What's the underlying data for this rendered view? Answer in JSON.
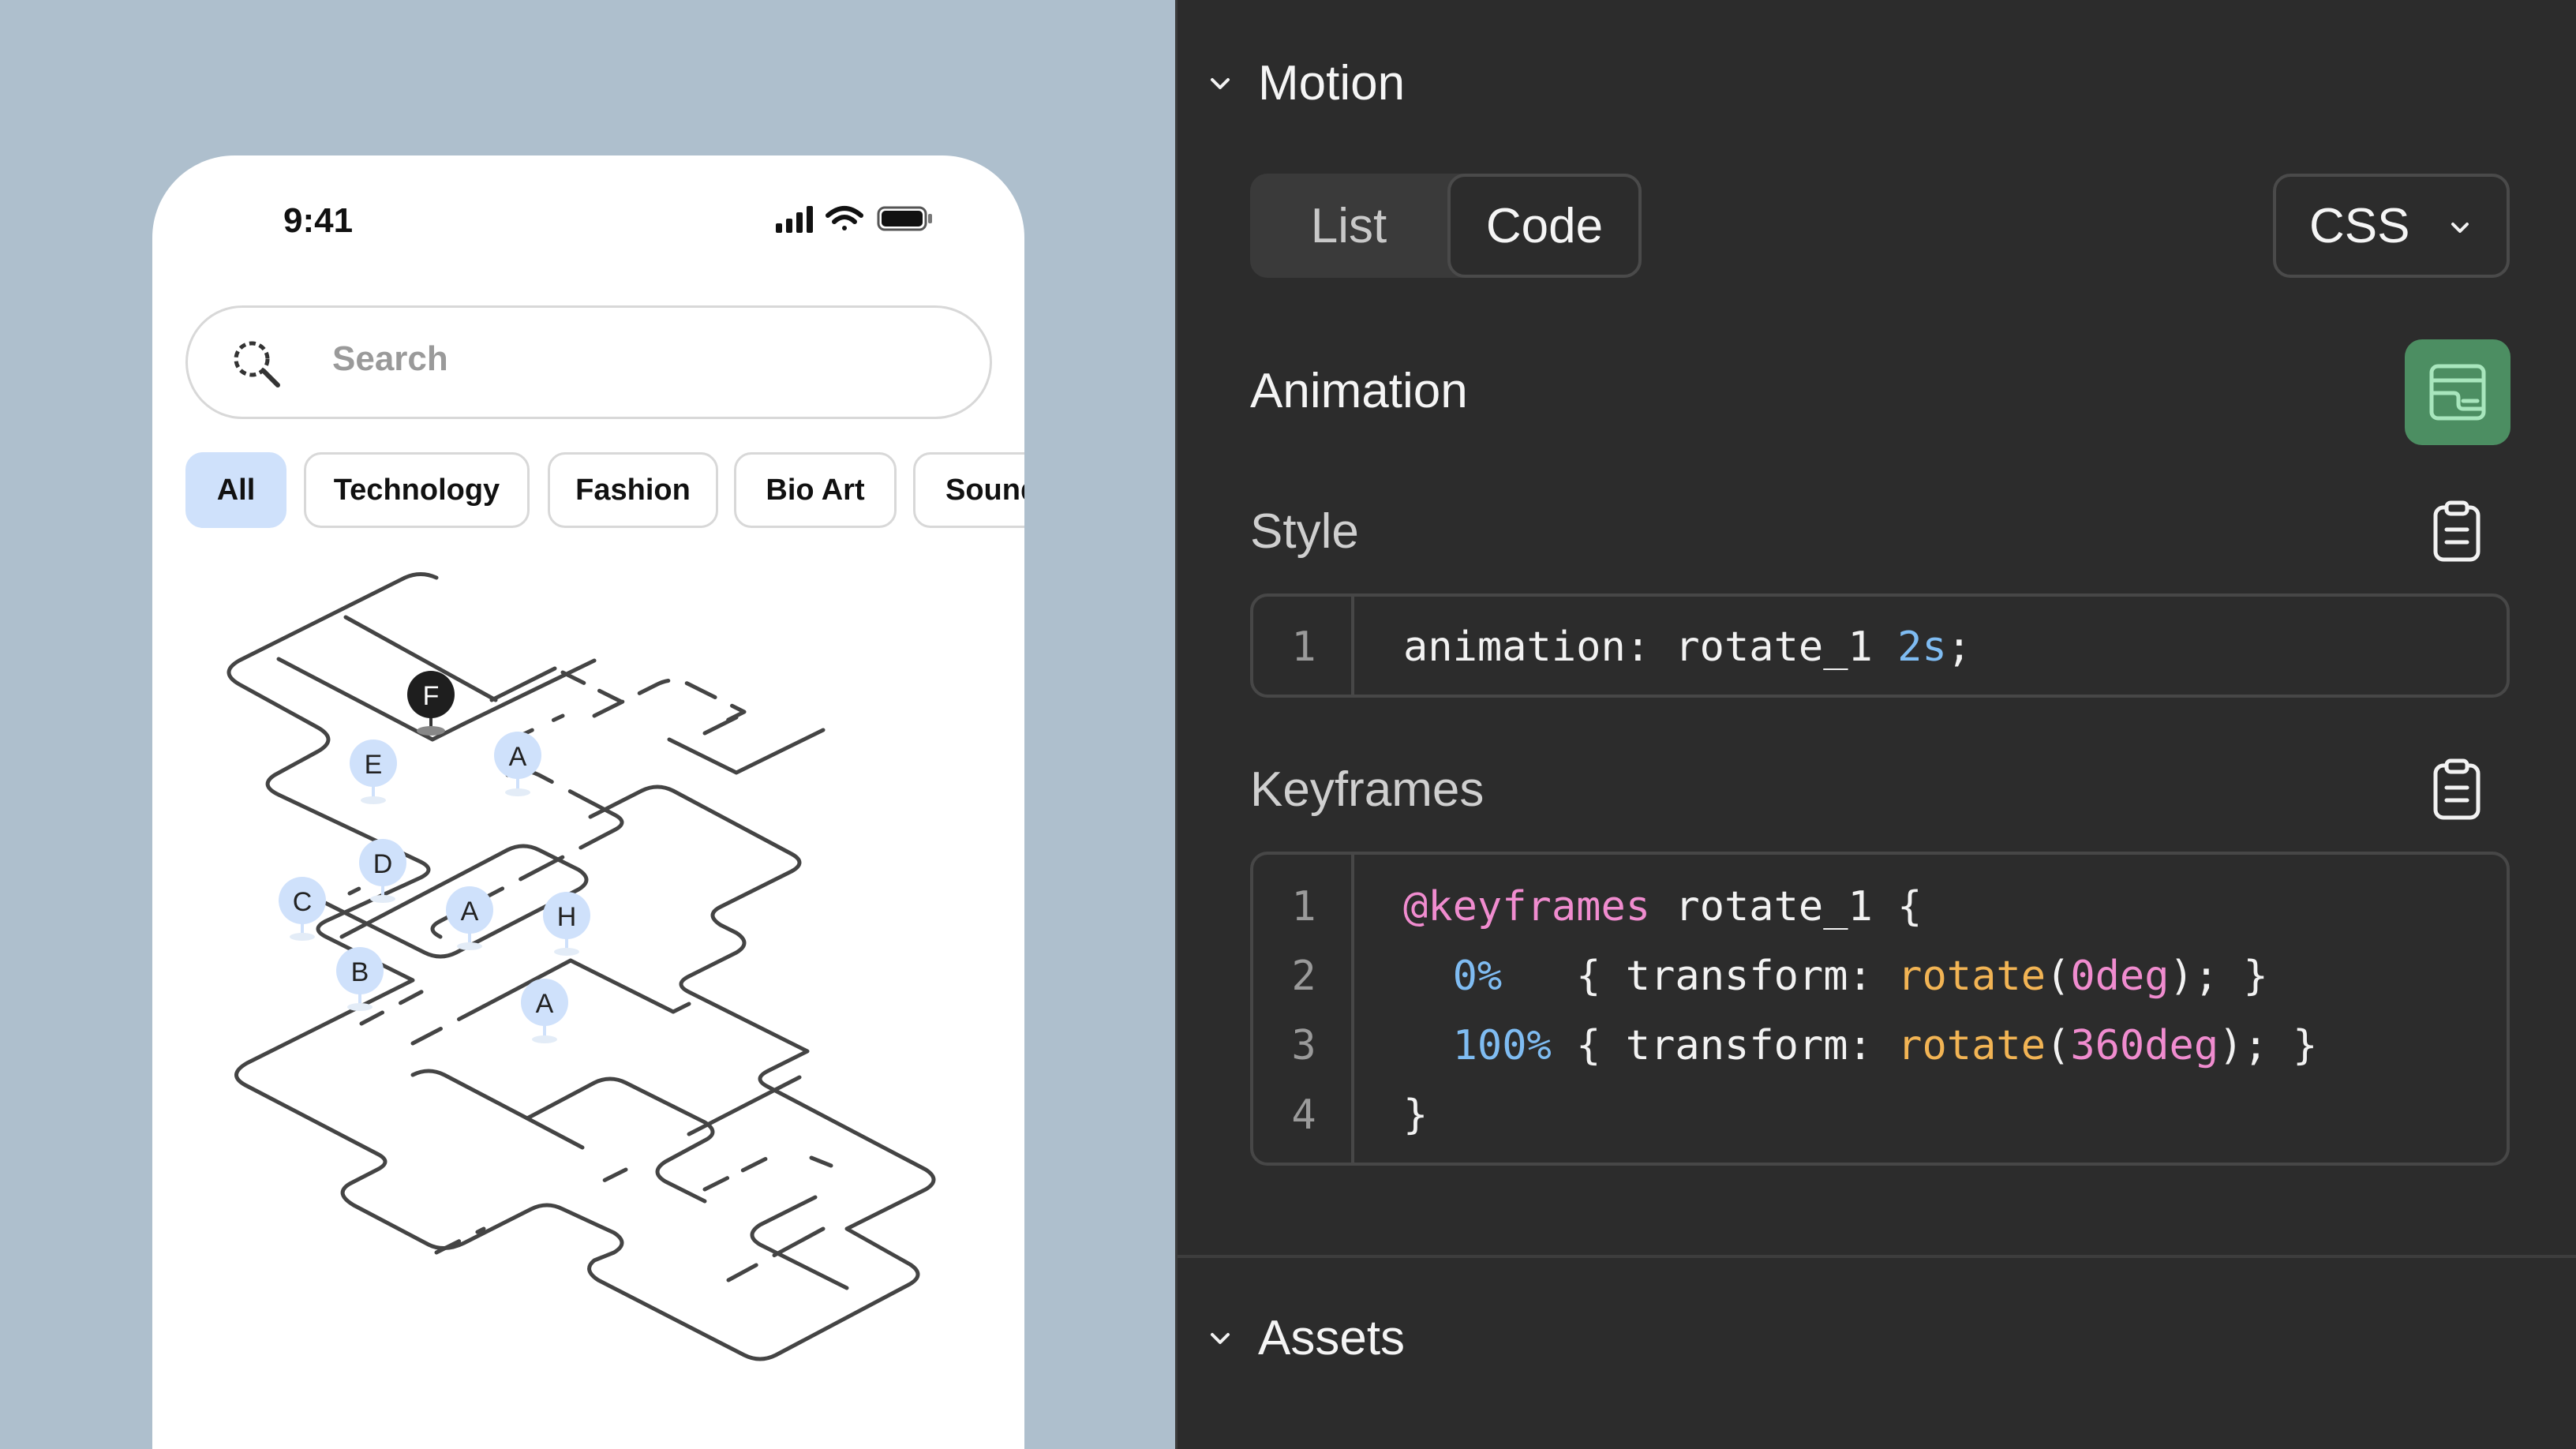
{
  "phone": {
    "time": "9:41",
    "search_placeholder": "Search",
    "chips": [
      "All",
      "Technology",
      "Fashion",
      "Bio Art",
      "Sound"
    ],
    "active_chip": "All",
    "markers": [
      {
        "label": "F",
        "style": "dark"
      },
      {
        "label": "E",
        "style": "light"
      },
      {
        "label": "A",
        "style": "light"
      },
      {
        "label": "D",
        "style": "light"
      },
      {
        "label": "C",
        "style": "light"
      },
      {
        "label": "A",
        "style": "light"
      },
      {
        "label": "H",
        "style": "light"
      },
      {
        "label": "B",
        "style": "light"
      },
      {
        "label": "A",
        "style": "light"
      }
    ]
  },
  "panel": {
    "motion_title": "Motion",
    "tabs": {
      "list": "List",
      "code": "Code",
      "active": "Code"
    },
    "language": "CSS",
    "animation_label": "Animation",
    "style_label": "Style",
    "style_code": {
      "line_number": "1",
      "prop": "animation: rotate_1 ",
      "value": "2s",
      "end": ";"
    },
    "keyframes_label": "Keyframes",
    "keyframes_lines": [
      {
        "n": "1",
        "at": "@keyframes",
        "rest": " rotate_1 {"
      },
      {
        "n": "2",
        "pct": "0%",
        "mid": "   { transform: ",
        "fn": "rotate",
        "open": "(",
        "arg": "0deg",
        "close": "); }"
      },
      {
        "n": "3",
        "pct": "100%",
        "mid": " { transform: ",
        "fn": "rotate",
        "open": "(",
        "arg": "360deg",
        "close": "); }"
      },
      {
        "n": "4",
        "text": "}"
      }
    ],
    "assets_title": "Assets"
  },
  "colors": {
    "left_bg": "#aebfcd",
    "panel_bg": "#2c2c2c",
    "chip_active": "#cfe1fb",
    "marker_light": "#cfe1fb",
    "marker_dark": "#1e1e1e",
    "accent_green": "#4c8e62",
    "code_blue": "#7fbcf2",
    "code_pink": "#f08ccf",
    "code_orange": "#f2b454"
  }
}
